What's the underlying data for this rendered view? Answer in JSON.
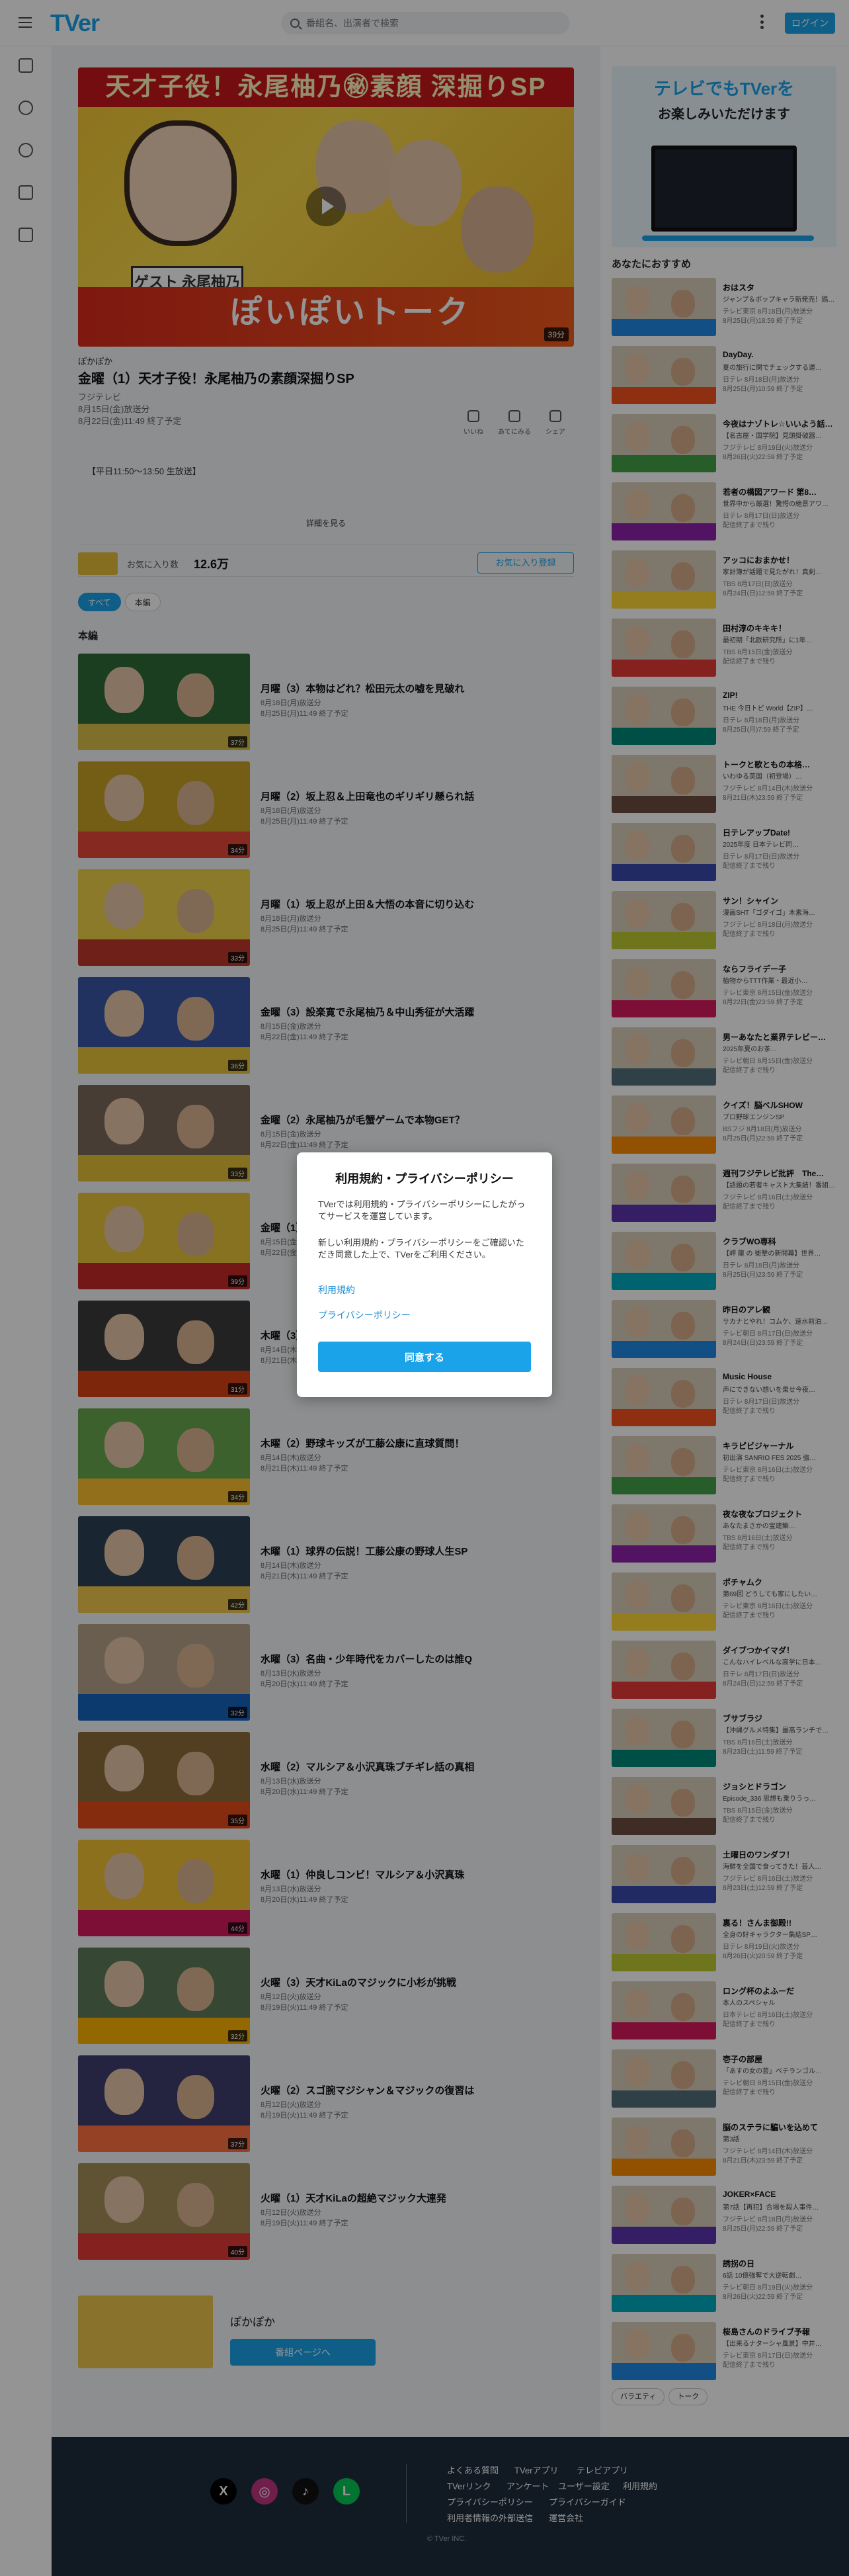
{
  "header": {
    "logo": "TVer",
    "search_placeholder": "番組名、出演者で検索",
    "login_label": "ログイン"
  },
  "episode": {
    "hero_banner": "天才子役！永尾柚乃㊙素顔 深掘りSP",
    "hero_guest": "ゲスト 永尾柚乃",
    "hero_show_logo": "ぽいぽいトーク",
    "duration": "39分",
    "series_name": "ぽかぽか",
    "title": "金曜（1）天才子役！永尾柚乃の素顔深掘りSP",
    "network": "フジテレビ",
    "aired": "8月15日(金)放送分",
    "expires": "8月22日(金)11:49 終了予定",
    "actions": [
      {
        "label": "いいね"
      },
      {
        "label": "あてにみる"
      },
      {
        "label": "シェア"
      }
    ],
    "broadcast_note": "【平日11:50〜13:50 生放送】",
    "more_label": "詳細を見る"
  },
  "favorite": {
    "label": "お気に入り数",
    "count": "12.6万",
    "button": "お気に入り登録"
  },
  "tags": [
    "すべて",
    "本編"
  ],
  "section_title": "本編",
  "episodes": [
    {
      "title": "月曜（3）本物はどれ？松田元太の嘘を見破れ",
      "aired": "8月18日(月)放送分",
      "expires": "8月25日(月)11:49 終了予定",
      "dur": "37分"
    },
    {
      "title": "月曜（2）坂上忍＆上田竜也のギリギリ懸られ話",
      "aired": "8月18日(月)放送分",
      "expires": "8月25日(月)11:49 終了予定",
      "dur": "34分"
    },
    {
      "title": "月曜（1）坂上忍が上田＆大悟の本音に切り込む",
      "aired": "8月18日(月)放送分",
      "expires": "8月25日(月)11:49 終了予定",
      "dur": "33分"
    },
    {
      "title": "金曜（3）設楽寛で永尾柚乃＆中山秀征が大活躍",
      "aired": "8月15日(金)放送分",
      "expires": "8月22日(金)11:49 終了予定",
      "dur": "36分"
    },
    {
      "title": "金曜（2）永尾柚乃が毛蟹ゲームで本物GET？",
      "aired": "8月15日(金)放送分",
      "expires": "8月22日(金)11:49 終了予定",
      "dur": "33分"
    },
    {
      "title": "金曜（1）天才子役！永尾柚乃の素顔深掘りSP",
      "aired": "8月15日(金)放送分",
      "expires": "8月22日(金)11:49 終了予定",
      "dur": "39分"
    },
    {
      "title": "木曜（3）野球キッズの知られざる素顔に迫る",
      "aired": "8月14日(木)放送分",
      "expires": "8月21日(木)11:49 終了予定",
      "dur": "31分"
    },
    {
      "title": "木曜（2）野球キッズが工藤公康に直球質問！",
      "aired": "8月14日(木)放送分",
      "expires": "8月21日(木)11:49 終了予定",
      "dur": "34分"
    },
    {
      "title": "木曜（1）球界の伝説！工藤公康の野球人生SP",
      "aired": "8月14日(木)放送分",
      "expires": "8月21日(木)11:49 終了予定",
      "dur": "42分"
    },
    {
      "title": "水曜（3）名曲・少年時代をカバーしたのは誰Q",
      "aired": "8月13日(水)放送分",
      "expires": "8月20日(水)11:49 終了予定",
      "dur": "32分"
    },
    {
      "title": "水曜（2）マルシア＆小沢真珠ブチギレ話の真相",
      "aired": "8月13日(水)放送分",
      "expires": "8月20日(水)11:49 終了予定",
      "dur": "35分"
    },
    {
      "title": "水曜（1）仲良しコンビ！マルシア＆小沢真珠",
      "aired": "8月13日(水)放送分",
      "expires": "8月20日(水)11:49 終了予定",
      "dur": "44分"
    },
    {
      "title": "火曜（3）天才KiLaのマジックに小杉が挑戦",
      "aired": "8月12日(火)放送分",
      "expires": "8月19日(火)11:49 終了予定",
      "dur": "32分"
    },
    {
      "title": "火曜（2）スゴ腕マジシャン＆マジックの復習は",
      "aired": "8月12日(火)放送分",
      "expires": "8月19日(火)11:49 終了予定",
      "dur": "37分"
    },
    {
      "title": "火曜（1）天才KiLaの超絶マジック大連発",
      "aired": "8月12日(火)放送分",
      "expires": "8月19日(火)11:49 終了予定",
      "dur": "40分"
    }
  ],
  "series_card": {
    "title": "ぽかぽか",
    "button": "番組ページへ"
  },
  "promo": {
    "line1": "テレビでもTVerを",
    "line2": "お楽しみいただけます"
  },
  "recommended_title": "あなたにおすすめ",
  "recommended": [
    {
      "title": "おはスタ",
      "sub": "ジャンプ＆ポップキャラ新発売！鶏…",
      "meta": "テレビ東京 8月18日(月)放送分",
      "exp": "8月25日(月)18:59 終了予定"
    },
    {
      "title": "DayDay.",
      "sub": "夏の旅行に関でチェックする運…",
      "meta": "日テレ 8月18日(月)放送分",
      "exp": "8月25日(月)10:59 終了予定"
    },
    {
      "title": "今夜はナゾトレ☆いいよう話…",
      "sub": "【名古屋・国学院】見頭掛破器…",
      "meta": "フジテレビ 8月19日(火)放送分",
      "exp": "8月26日(火)22:59 終了予定"
    },
    {
      "title": "若者の構図アワード 第8…",
      "sub": "世界中から厳選！驚愕の絶景アワ…",
      "meta": "日テレ 8月17日(日)放送分",
      "exp": "配信終了まで残り"
    },
    {
      "title": "アッコにおまかせ！",
      "sub": "家計簿が話題で見たがれ！真剣…",
      "meta": "TBS 8月17日(日)放送分",
      "exp": "8月24日(日)12:59 終了予定"
    },
    {
      "title": "田村淳のキキキ！",
      "sub": "最初期「北欧研究所」に1年…",
      "meta": "TBS 8月15日(金)放送分",
      "exp": "配信終了まで残り"
    },
    {
      "title": "ZIP!",
      "sub": "THE 今日トピ World【ZIP】…",
      "meta": "日テレ 8月18日(月)放送分",
      "exp": "8月25日(月)7:59 終了予定"
    },
    {
      "title": "トークと歌ともの本格…",
      "sub": "いわゆる英国（初登場）…",
      "meta": "フジテレビ 8月14日(木)放送分",
      "exp": "8月21日(木)23:59 終了予定"
    },
    {
      "title": "日テレアップDate!",
      "sub": "2025年度 日本テレビ同…",
      "meta": "日テレ 8月17日(日)放送分",
      "exp": "配信終了まで残り"
    },
    {
      "title": "サン！シャイン",
      "sub": "漫画SHT「ゴダイゴ」木素海…",
      "meta": "フジテレビ 8月18日(月)放送分",
      "exp": "配信終了まで残り"
    },
    {
      "title": "ならフライデー子",
      "sub": "植物からTTT作業・最近小…",
      "meta": "テレビ東京 8月15日(金)放送分",
      "exp": "8月22日(金)23:59 終了予定"
    },
    {
      "title": "男ーあなたと業界テレビー…",
      "sub": "2025年夏のお茶…",
      "meta": "テレビ朝日 8月15日(金)放送分",
      "exp": "配信終了まで残り"
    },
    {
      "title": "クイズ！脳ベルSHOW",
      "sub": "プロ野球エンジンSP",
      "meta": "BSフジ 8月18日(月)放送分",
      "exp": "8月25日(月)22:59 終了予定"
    },
    {
      "title": "週刊フジテレビ批評　The…",
      "sub": "【話題の若者キャスト大集結！番組…",
      "meta": "フジテレビ 8月16日(土)放送分",
      "exp": "配信終了まで残り"
    },
    {
      "title": "クラブWO専科",
      "sub": "【岬 龍 の 衝撃の新開幕】世界…",
      "meta": "日テレ 8月18日(月)放送分",
      "exp": "8月25日(月)23:59 終了予定"
    },
    {
      "title": "昨日のアレ観",
      "sub": "サカナとやれ！コムケ、速水前泊…",
      "meta": "テレビ朝日 8月17日(日)放送分",
      "exp": "8月24日(日)23:59 終了予定"
    },
    {
      "title": "Music House",
      "sub": "声にできない想いを乗せ今夜…",
      "meta": "日テレ 8月17日(日)放送分",
      "exp": "配信終了まで残り"
    },
    {
      "title": "キラピビジャーナル",
      "sub": "初出演 SANRIO FES 2025 強…",
      "meta": "テレビ東京 8月16日(土)放送分",
      "exp": "配信終了まで残り"
    },
    {
      "title": "夜な夜なプロジェクト",
      "sub": "あなたまさかの宝建築…",
      "meta": "TBS 8月16日(土)放送分",
      "exp": "配信終了まで残り"
    },
    {
      "title": "ポチャムク",
      "sub": "第69回 どうしても家にしたい…",
      "meta": "テレビ東京 8月16日(土)放送分",
      "exp": "配信終了まで残り"
    },
    {
      "title": "ダイブつかイマダ！",
      "sub": "こんなハイレベルな高学に日本…",
      "meta": "日テレ 8月17日(日)放送分",
      "exp": "8月24日(日)12:59 終了予定"
    },
    {
      "title": "ブサブラジ",
      "sub": "【沖縄グルメ特集】最高ランチで…",
      "meta": "TBS 8月16日(土)放送分",
      "exp": "8月23日(土)11:59 終了予定"
    },
    {
      "title": "ジョシとドラゴン",
      "sub": "Episode_336 思想も乗りうっ…",
      "meta": "TBS 8月15日(金)放送分",
      "exp": "配信終了まで残り"
    },
    {
      "title": "土曜日のワンダフ！",
      "sub": "海鮮を全国で食ってきた！芸人…",
      "meta": "フジテレビ 8月16日(土)放送分",
      "exp": "8月23日(土)12:59 終了予定"
    },
    {
      "title": "裏る！さんま御殿!!",
      "sub": "全身の好キャラクター集結SP…",
      "meta": "日テレ 8月19日(火)放送分",
      "exp": "8月26日(火)20:59 終了予定"
    },
    {
      "title": "ロング杯のよふーだ",
      "sub": "本人のスペシャル",
      "meta": "日本テレビ 8月16日(土)放送分",
      "exp": "配信終了まで残り"
    },
    {
      "title": "壱子の部屋",
      "sub": "「あすの女の芸」ベテランゴル…",
      "meta": "テレビ朝日 8月15日(金)放送分",
      "exp": "配信終了まで残り"
    },
    {
      "title": "脳のステラに騙いを込めて",
      "sub": "第3話",
      "meta": "フジテレビ 8月14日(木)放送分",
      "exp": "8月21日(木)23:59 終了予定"
    },
    {
      "title": "JOKER×FACE",
      "sub": "第7話【再犯】合場を殺人事件…",
      "meta": "フジテレビ 8月18日(月)放送分",
      "exp": "8月25日(月)22:59 終了予定"
    },
    {
      "title": "誘拐の日",
      "sub": "6話 10億強奪で大逆転劇…",
      "meta": "テレビ朝日 8月19日(火)放送分",
      "exp": "8月26日(火)22:59 終了予定"
    },
    {
      "title": "桜島さんのドライブ予報",
      "sub": "【出来るナターシャ風景】中井…",
      "meta": "テレビ東京 8月17日(日)放送分",
      "exp": "配信終了まで残り"
    }
  ],
  "genres": [
    "バラエティ",
    "トーク"
  ],
  "footer": {
    "social": [
      {
        "icon": "x-icon",
        "glyph": "X"
      },
      {
        "icon": "instagram-icon",
        "glyph": "◎"
      },
      {
        "icon": "tiktok-icon",
        "glyph": "♪"
      },
      {
        "icon": "line-icon",
        "glyph": "L"
      }
    ],
    "row1": [
      "よくある質問",
      "TVerアプリ",
      "テレビアプリ"
    ],
    "row2": [
      "TVerリンク",
      "アンケート",
      "ユーザー設定",
      "利用規約"
    ],
    "row3": [
      "プライバシーポリシー",
      "プライバシーガイド"
    ],
    "row4": [
      "利用者情報の外部送信",
      "運営会社"
    ],
    "copyright": "© TVer INC."
  },
  "modal": {
    "title": "利用規約・プライバシーポリシー",
    "text1": "TVerでは利用規約・プライバシーポリシーにしたがってサービスを運営しています。",
    "text2": "新しい利用規約・プライバシーポリシーをご確認いただき同意した上で、TVerをご利用ください。",
    "link1": "利用規約",
    "link2": "プライバシーポリシー",
    "agree": "同意する"
  },
  "colors": {
    "accent": "#1aa3e8",
    "footer_bg": "#1e2b3c"
  }
}
